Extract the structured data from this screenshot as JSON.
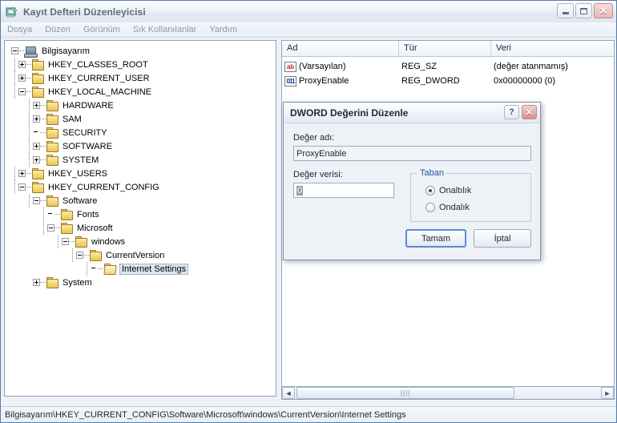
{
  "window": {
    "title": "Kayıt Defteri Düzenleyicisi",
    "icon": "registry-editor-icon",
    "minimize_label": "",
    "maximize_label": "",
    "close_label": "✕"
  },
  "menu": {
    "items": [
      {
        "label": "Dosya"
      },
      {
        "label": "Düzen"
      },
      {
        "label": "Görünüm"
      },
      {
        "label": "Sık Kullanılanlar"
      },
      {
        "label": "Yardım"
      }
    ]
  },
  "tree": {
    "nodes": [
      {
        "label": "Bilgisayarım",
        "icon": "computer-icon",
        "state": "expanded"
      },
      {
        "label": "HKEY_CLASSES_ROOT",
        "icon": "folder-icon",
        "state": "collapsed"
      },
      {
        "label": "HKEY_CURRENT_USER",
        "icon": "folder-icon",
        "state": "collapsed"
      },
      {
        "label": "HKEY_LOCAL_MACHINE",
        "icon": "folder-icon",
        "state": "expanded"
      },
      {
        "label": "HARDWARE",
        "icon": "folder-icon",
        "state": "collapsed"
      },
      {
        "label": "SAM",
        "icon": "folder-icon",
        "state": "collapsed"
      },
      {
        "label": "SECURITY",
        "icon": "folder-icon",
        "state": "leaf"
      },
      {
        "label": "SOFTWARE",
        "icon": "folder-icon",
        "state": "collapsed"
      },
      {
        "label": "SYSTEM",
        "icon": "folder-icon",
        "state": "collapsed"
      },
      {
        "label": "HKEY_USERS",
        "icon": "folder-icon",
        "state": "collapsed"
      },
      {
        "label": "HKEY_CURRENT_CONFIG",
        "icon": "folder-icon",
        "state": "expanded"
      },
      {
        "label": "Software",
        "icon": "folder-icon",
        "state": "expanded"
      },
      {
        "label": "Fonts",
        "icon": "folder-icon",
        "state": "leaf"
      },
      {
        "label": "Microsoft",
        "icon": "folder-icon",
        "state": "expanded"
      },
      {
        "label": "windows",
        "icon": "folder-icon",
        "state": "expanded"
      },
      {
        "label": "CurrentVersion",
        "icon": "folder-icon",
        "state": "expanded"
      },
      {
        "label": "Internet Settings",
        "icon": "folder-open-icon",
        "state": "selected"
      },
      {
        "label": "System",
        "icon": "folder-icon",
        "state": "collapsed"
      }
    ]
  },
  "values": {
    "columns": [
      "Ad",
      "Tür",
      "Veri"
    ],
    "rows": [
      {
        "icon": "string-value-icon",
        "icon_text": "ab",
        "name": "(Varsayılan)",
        "type": "REG_SZ",
        "data": "(değer atanmamış)"
      },
      {
        "icon": "binary-value-icon",
        "icon_text": "011",
        "name": "ProxyEnable",
        "type": "REG_DWORD",
        "data": "0x00000000 (0)"
      }
    ]
  },
  "scrollbar": {
    "left_arrow": "◄",
    "right_arrow": "►",
    "grip": "||||"
  },
  "statusbar": {
    "path": "Bilgisayarım\\HKEY_CURRENT_CONFIG\\Software\\Microsoft\\windows\\CurrentVersion\\Internet Settings"
  },
  "dialog": {
    "title": "DWORD Değerini Düzenle",
    "help_label": "?",
    "close_label": "✕",
    "value_name_label": "Değer adı:",
    "value_name": "ProxyEnable",
    "value_data_label": "Değer verisi:",
    "value_data": "0",
    "base_group_label": "Taban",
    "base_options": [
      {
        "label": "Onaltılık",
        "checked": true
      },
      {
        "label": "Ondalık",
        "checked": false
      }
    ],
    "ok_label": "Tamam",
    "cancel_label": "İptal"
  },
  "colors": {
    "titlebar_text": "#5c6a7e",
    "group_label": "#24559e",
    "selection": "#d8e4f2",
    "close_button": "#d98f8f",
    "default_button_border": "#5b8bd0"
  }
}
